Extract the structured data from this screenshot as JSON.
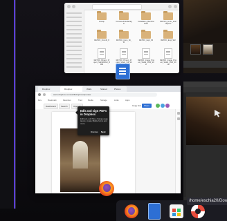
{
  "file_manager": {
    "row1": [
      {
        "name": "bitmap"
      },
      {
        "name": "ContainerFileManager"
      },
      {
        "name": "Installation_MachineData"
      },
      {
        "name": "RETRO_Anniv_anklObjects"
      }
    ],
    "row2": [
      {
        "name": "RETRO_Fromi6_8"
      },
      {
        "name": "RETRO_Cons_Sli_M"
      },
      {
        "name": "RETRO_Expl_Sll"
      },
      {
        "name": "RETRO_Expl_Sll2"
      }
    ],
    "row3": [
      {
        "name": "RETRO_Pinaon_Project_StarSillSbm_BMM"
      },
      {
        "name": "RETRO_Pinaon_Project_Shark_Sill_Sbm"
      },
      {
        "name": "RETRO_Image_Project_Shark_SSN_Sbm"
      },
      {
        "name": "RETRO_Image_Project_Shark_SSN_Sbm2"
      }
    ]
  },
  "browser": {
    "tabs": [
      "Dropbox",
      "Dropbox",
      "Walls",
      "Shared",
      "Photos"
    ],
    "address": "www.dropbox.com/scl/fi/dropbox/preview",
    "bookmarks": [
      "Dev",
      "Bookmark",
      "Favorites",
      "Trad",
      "Media",
      "Storage",
      "Links",
      "Apps"
    ],
    "toolbar": {
      "back_label": "Dashboard",
      "search_label": "Search",
      "open_label": "Open in",
      "copy_link": "Copy link",
      "share": "Share"
    }
  },
  "tooltip": {
    "title": "Edit and sign PDFs in Dropbox",
    "body": "Edit text, add files, change page layout, create fillable forms and more.",
    "dismiss": "Dismiss",
    "next": "Next"
  },
  "taskbar": {
    "path_tooltip": "/home/eschia20/Dow"
  },
  "icons": {
    "folder": "folder-icon",
    "document": "document-icon",
    "firefox": "firefox-icon",
    "files": "file-manager-icon",
    "store": "store-icon",
    "help": "lifebuoy-icon"
  }
}
